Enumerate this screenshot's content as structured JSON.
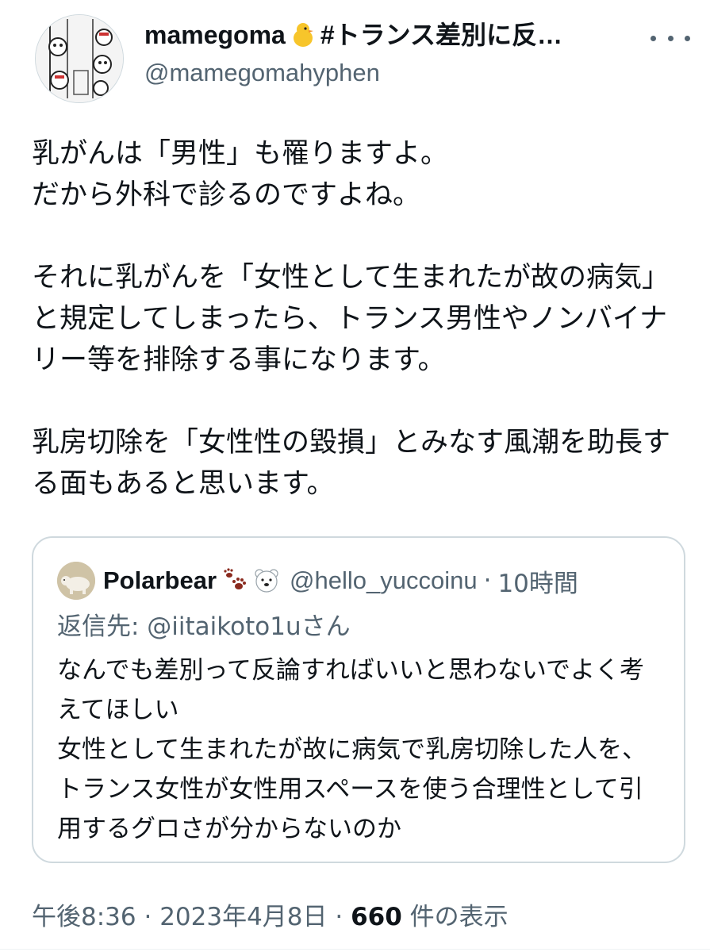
{
  "author": {
    "display_name_prefix": "mamegoma",
    "display_name_emoji": "chick-emoji",
    "display_name_suffix": "#トランス差別に反…",
    "handle": "@mamegomahyphen"
  },
  "tweet": {
    "text": "乳がんは「男性」も罹りますよ。\nだから外科で診るのですよね。\n\nそれに乳がんを「女性として生まれたが故の病気」と規定してしまったら、トランス男性やノンバイナリー等を排除する事になります。\n\n乳房切除を「女性性の毀損」とみなす風潮を助長する面もあると思います。"
  },
  "quoted": {
    "name": "Polarbear",
    "emojis": [
      "paw-prints-emoji",
      "polar-bear-emoji"
    ],
    "handle": "@hello_yuccoinu",
    "separator": "·",
    "time": "10時間",
    "reply_to": "返信先: @iitaikoto1uさん",
    "text": "なんでも差別って反論すればいいと思わないでよく考えてほしい\n女性として生まれたが故に病気で乳房切除した人を、トランス女性が女性用スペースを使う合理性として引用するグロさが分からないのか"
  },
  "meta": {
    "time": "午後8:36",
    "sep1": " · ",
    "date": "2023年4月8日",
    "sep2": " · ",
    "views": "660",
    "views_label": " 件の表示"
  },
  "colors": {
    "text": "#0f1419",
    "secondary": "#536471",
    "border": "#cfd9de"
  }
}
